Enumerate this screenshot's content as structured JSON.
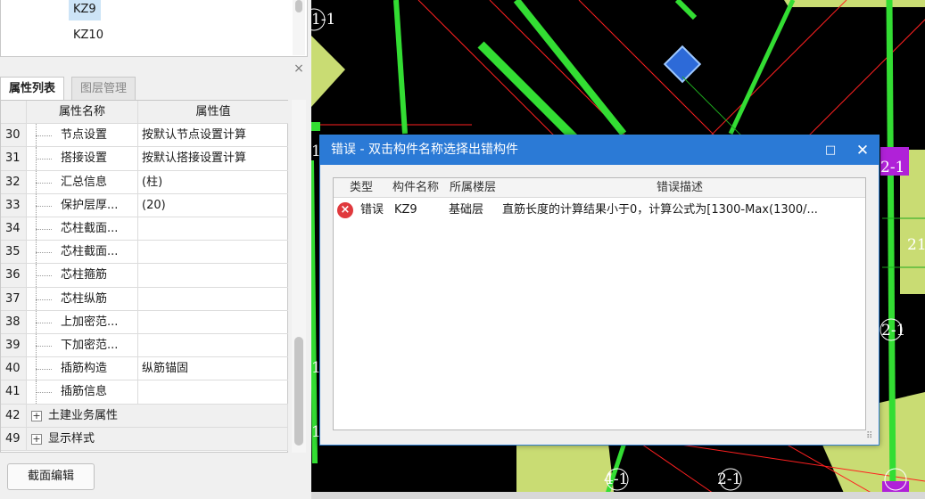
{
  "component_list": {
    "items": [
      {
        "label": "KZ9",
        "selected": true
      },
      {
        "label": "KZ10",
        "selected": false
      }
    ]
  },
  "panel": {
    "close_glyph": "×",
    "tabs": [
      {
        "label": "属性列表",
        "active": true
      },
      {
        "label": "图层管理",
        "active": false
      }
    ]
  },
  "property_grid": {
    "headers": {
      "name": "属性名称",
      "value": "属性值"
    },
    "rows": [
      {
        "no": "30",
        "name": "节点设置",
        "value": "按默认节点设置计算"
      },
      {
        "no": "31",
        "name": "搭接设置",
        "value": "按默认搭接设置计算"
      },
      {
        "no": "32",
        "name": "汇总信息",
        "value": "(柱)"
      },
      {
        "no": "33",
        "name": "保护层厚...",
        "value": "(20)"
      },
      {
        "no": "34",
        "name": "芯柱截面...",
        "value": ""
      },
      {
        "no": "35",
        "name": "芯柱截面...",
        "value": ""
      },
      {
        "no": "36",
        "name": "芯柱箍筋",
        "value": ""
      },
      {
        "no": "37",
        "name": "芯柱纵筋",
        "value": ""
      },
      {
        "no": "38",
        "name": "上加密范...",
        "value": ""
      },
      {
        "no": "39",
        "name": "下加密范...",
        "value": ""
      },
      {
        "no": "40",
        "name": "插筋构造",
        "value": "纵筋锚固"
      },
      {
        "no": "41",
        "name": "插筋信息",
        "value": ""
      }
    ],
    "groups": [
      {
        "no": "42",
        "name": "土建业务属性",
        "expander": "+"
      },
      {
        "no": "49",
        "name": "显示样式",
        "expander": "+"
      }
    ]
  },
  "section_edit_button": "截面编辑",
  "canvas": {
    "background": "#000000",
    "rebar_color": "#33dd33",
    "slab_color": "#c9dc73",
    "grid_line_color": "#ff2020",
    "axis_labels": [
      "1-1",
      "1",
      "1",
      "1",
      "2-1",
      "21",
      "2-1",
      "4-1",
      "2-1"
    ]
  },
  "error_dialog": {
    "title": "错误 - 双击构件名称选择出错构件",
    "maximize_glyph": "□",
    "close_glyph": "✕",
    "columns": [
      "类型",
      "构件名称",
      "所属楼层",
      "错误描述"
    ],
    "rows": [
      {
        "icon": "error-icon",
        "type": "错误",
        "component": "KZ9",
        "floor": "基础层",
        "description": "直筋长度的计算结果小于0，计算公式为[1300-Max(1300/..."
      }
    ],
    "title_color": "#2b7ad6"
  }
}
